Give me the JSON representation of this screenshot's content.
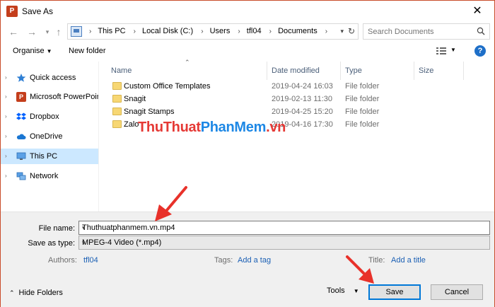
{
  "window": {
    "title": "Save As",
    "app_icon_text": "P"
  },
  "address": {
    "crumbs": [
      "This PC",
      "Local Disk (C:)",
      "Users",
      "tfl04",
      "Documents"
    ]
  },
  "search": {
    "placeholder": "Search Documents"
  },
  "toolbar": {
    "organise_label": "Organise",
    "new_folder_label": "New folder"
  },
  "nav": {
    "items": [
      {
        "label": "Quick access",
        "icon": "star-icon"
      },
      {
        "label": "Microsoft PowerPoin",
        "icon": "powerpoint-icon"
      },
      {
        "label": "Dropbox",
        "icon": "dropbox-icon"
      },
      {
        "label": "OneDrive",
        "icon": "cloud-icon"
      },
      {
        "label": "This PC",
        "icon": "computer-icon",
        "selected": true
      },
      {
        "label": "Network",
        "icon": "network-icon"
      }
    ]
  },
  "files": {
    "columns": [
      "Name",
      "Date modified",
      "Type",
      "Size"
    ],
    "rows": [
      {
        "name": "Custom Office Templates",
        "date": "2019-04-24 16:03",
        "type": "File folder"
      },
      {
        "name": "Snagit",
        "date": "2019-02-13 11:30",
        "type": "File folder"
      },
      {
        "name": "Snagit Stamps",
        "date": "2019-04-25 15:20",
        "type": "File folder"
      },
      {
        "name": "Zalo",
        "date": "2019-04-16 17:30",
        "type": "File folder"
      }
    ]
  },
  "watermark": {
    "part1": "ThuThuat",
    "part2": "PhanMem",
    "part3": ".vn"
  },
  "form": {
    "file_name_label": "File name:",
    "file_name_value": "Thuthuatphanmem.vn.mp4",
    "save_type_label": "Save as type:",
    "save_type_value": "MPEG-4 Video (*.mp4)",
    "authors_label": "Authors:",
    "authors_value": "tfl04",
    "tags_label": "Tags:",
    "tags_value": "Add a tag",
    "title_label": "Title:",
    "title_value": "Add a title"
  },
  "footer": {
    "hide_folders_label": "Hide Folders",
    "tools_label": "Tools",
    "save_label": "Save",
    "cancel_label": "Cancel"
  },
  "colors": {
    "accent": "#0078d7",
    "arrow": "#e8312a",
    "selected_bg": "#cce8ff"
  }
}
